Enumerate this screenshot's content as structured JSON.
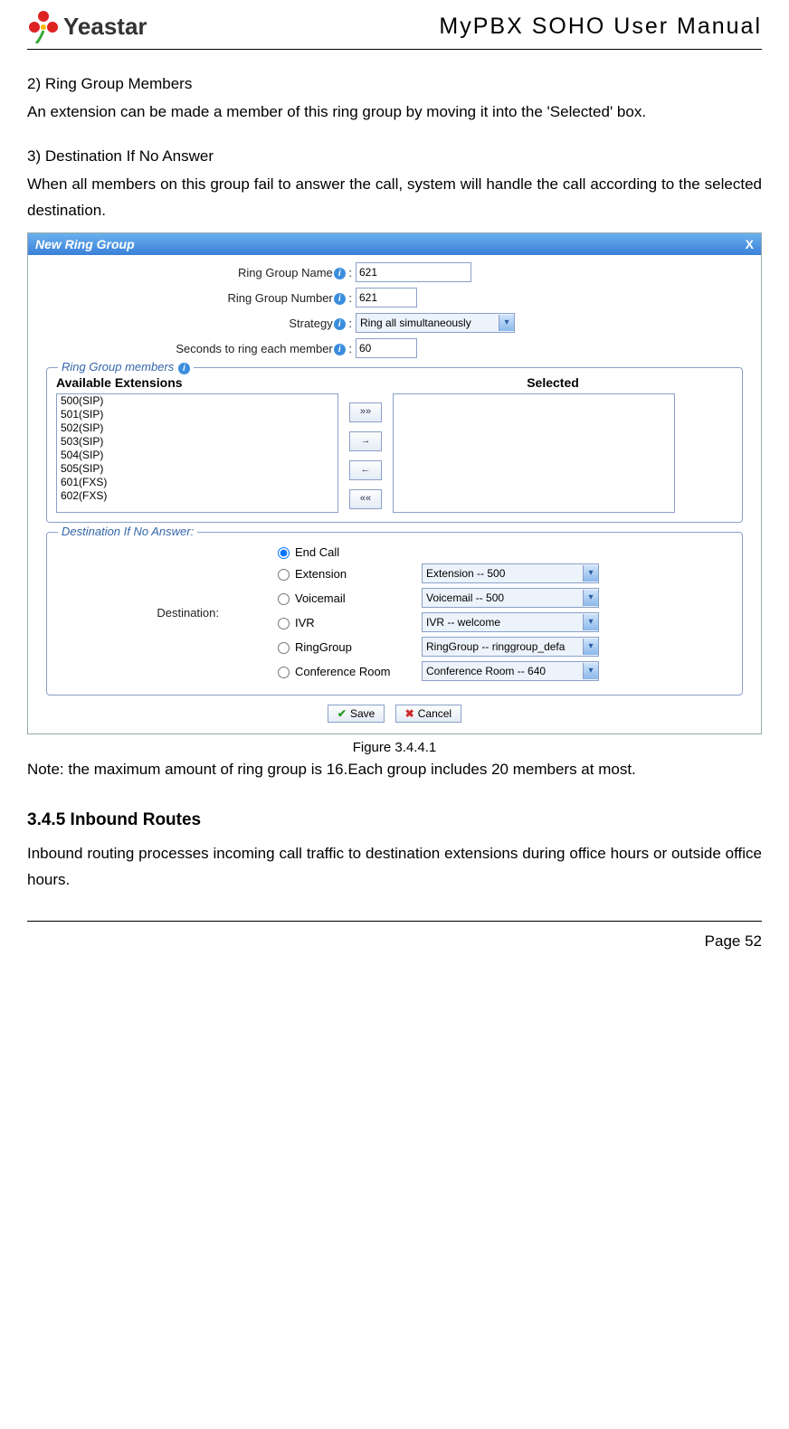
{
  "header": {
    "brand": "Yeastar",
    "doc_title": "MyPBX  SOHO  User  Manual"
  },
  "sections": {
    "s2_title": "2) Ring Group Members",
    "s2_body": "An extension can be made a member of this ring group by moving it into the 'Selected' box.",
    "s3_title": "3) Destination If No Answer",
    "s3_body": "When all members on this group fail to answer the call, system will handle the call according to the selected destination."
  },
  "dialog": {
    "title": "New Ring Group",
    "close": "X",
    "fields": {
      "name_label": "Ring Group Name",
      "name_value": "621",
      "number_label": "Ring Group Number",
      "number_value": "621",
      "strategy_label": "Strategy",
      "strategy_value": "Ring all simultaneously",
      "seconds_label": "Seconds to ring each member",
      "seconds_value": "60"
    },
    "members": {
      "legend": "Ring Group members",
      "available_heading": "Available Extensions",
      "selected_heading": "Selected",
      "available": [
        "500(SIP)",
        "501(SIP)",
        "502(SIP)",
        "503(SIP)",
        "504(SIP)",
        "505(SIP)",
        "601(FXS)",
        "602(FXS)"
      ],
      "btn_all_right": "»»",
      "btn_right": "→",
      "btn_left": "←",
      "btn_all_left": "««"
    },
    "dest": {
      "legend": "Destination If No Answer:",
      "side_label": "Destination:",
      "options": [
        {
          "label": "End Call",
          "select": null,
          "checked": true
        },
        {
          "label": "Extension",
          "select": "Extension -- 500"
        },
        {
          "label": "Voicemail",
          "select": "Voicemail -- 500"
        },
        {
          "label": "IVR",
          "select": "IVR -- welcome"
        },
        {
          "label": "RingGroup",
          "select": "RingGroup -- ringgroup_defa"
        },
        {
          "label": "Conference Room",
          "select": "Conference Room -- 640"
        }
      ]
    },
    "actions": {
      "save": "Save",
      "cancel": "Cancel"
    }
  },
  "caption": "Figure 3.4.4.1",
  "note": "Note: the maximum amount of ring group is 16.Each group includes 20 members at most.",
  "subsection_title": "3.4.5 Inbound Routes",
  "subsection_body": "Inbound routing processes incoming call traffic to destination extensions during office hours or outside office hours.",
  "footer": "Page 52"
}
